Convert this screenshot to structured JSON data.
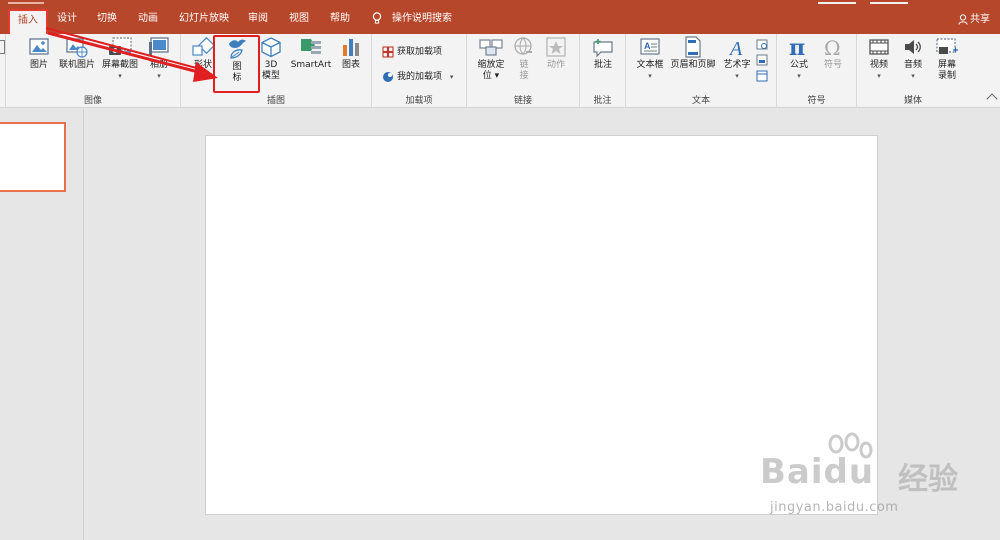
{
  "tabs": [
    {
      "label": "插入",
      "active": true
    },
    {
      "label": "设计"
    },
    {
      "label": "切换"
    },
    {
      "label": "动画"
    },
    {
      "label": "幻灯片放映"
    },
    {
      "label": "审阅"
    },
    {
      "label": "视图"
    },
    {
      "label": "帮助"
    },
    {
      "label": "操作说明搜索"
    }
  ],
  "share_label": "共享",
  "groups": {
    "image": {
      "label": "图像",
      "picture": "图片",
      "online_picture": "联机图片",
      "screenshot": "屏幕截图",
      "album": "相册"
    },
    "illustration": {
      "label": "插图",
      "shapes": "形状",
      "icons_line1": "图",
      "icons_line2": "标",
      "model3d_line1": "3D",
      "model3d_line2": "模型",
      "smartart": "SmartArt",
      "chart": "图表"
    },
    "addins": {
      "label": "加载项",
      "get": "获取加载项",
      "my": "我的加载项"
    },
    "links": {
      "label": "链接",
      "zoom_line1": "缩放定",
      "zoom_line2": "位",
      "link_line1": "链",
      "link_line2": "接",
      "action": "动作"
    },
    "comments": {
      "label": "批注",
      "comment": "批注"
    },
    "text": {
      "label": "文本",
      "textbox": "文本框",
      "header_footer": "页眉和页脚",
      "wordart": "艺术字"
    },
    "symbols": {
      "label": "符号",
      "equation": "公式",
      "symbol": "符号"
    },
    "media": {
      "label": "媒体",
      "video": "视频",
      "audio": "音频",
      "record_line1": "屏幕",
      "record_line2": "录制"
    }
  },
  "watermark": {
    "brand": "Baidu",
    "cn": "经验",
    "url": "jingyan.baidu.com"
  },
  "colors": {
    "accent": "#b7472a",
    "highlight": "#e02020"
  }
}
